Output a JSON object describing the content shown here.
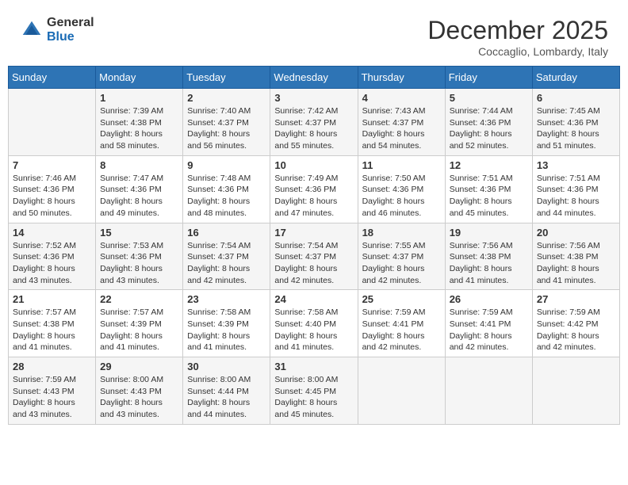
{
  "header": {
    "logo_general": "General",
    "logo_blue": "Blue",
    "month_title": "December 2025",
    "location": "Coccaglio, Lombardy, Italy"
  },
  "days_of_week": [
    "Sunday",
    "Monday",
    "Tuesday",
    "Wednesday",
    "Thursday",
    "Friday",
    "Saturday"
  ],
  "weeks": [
    [
      {
        "day": "",
        "sunrise": "",
        "sunset": "",
        "daylight": ""
      },
      {
        "day": "1",
        "sunrise": "7:39 AM",
        "sunset": "4:38 PM",
        "daylight": "8 hours and 58 minutes."
      },
      {
        "day": "2",
        "sunrise": "7:40 AM",
        "sunset": "4:37 PM",
        "daylight": "8 hours and 56 minutes."
      },
      {
        "day": "3",
        "sunrise": "7:42 AM",
        "sunset": "4:37 PM",
        "daylight": "8 hours and 55 minutes."
      },
      {
        "day": "4",
        "sunrise": "7:43 AM",
        "sunset": "4:37 PM",
        "daylight": "8 hours and 54 minutes."
      },
      {
        "day": "5",
        "sunrise": "7:44 AM",
        "sunset": "4:36 PM",
        "daylight": "8 hours and 52 minutes."
      },
      {
        "day": "6",
        "sunrise": "7:45 AM",
        "sunset": "4:36 PM",
        "daylight": "8 hours and 51 minutes."
      }
    ],
    [
      {
        "day": "7",
        "sunrise": "7:46 AM",
        "sunset": "4:36 PM",
        "daylight": "8 hours and 50 minutes."
      },
      {
        "day": "8",
        "sunrise": "7:47 AM",
        "sunset": "4:36 PM",
        "daylight": "8 hours and 49 minutes."
      },
      {
        "day": "9",
        "sunrise": "7:48 AM",
        "sunset": "4:36 PM",
        "daylight": "8 hours and 48 minutes."
      },
      {
        "day": "10",
        "sunrise": "7:49 AM",
        "sunset": "4:36 PM",
        "daylight": "8 hours and 47 minutes."
      },
      {
        "day": "11",
        "sunrise": "7:50 AM",
        "sunset": "4:36 PM",
        "daylight": "8 hours and 46 minutes."
      },
      {
        "day": "12",
        "sunrise": "7:51 AM",
        "sunset": "4:36 PM",
        "daylight": "8 hours and 45 minutes."
      },
      {
        "day": "13",
        "sunrise": "7:51 AM",
        "sunset": "4:36 PM",
        "daylight": "8 hours and 44 minutes."
      }
    ],
    [
      {
        "day": "14",
        "sunrise": "7:52 AM",
        "sunset": "4:36 PM",
        "daylight": "8 hours and 43 minutes."
      },
      {
        "day": "15",
        "sunrise": "7:53 AM",
        "sunset": "4:36 PM",
        "daylight": "8 hours and 43 minutes."
      },
      {
        "day": "16",
        "sunrise": "7:54 AM",
        "sunset": "4:37 PM",
        "daylight": "8 hours and 42 minutes."
      },
      {
        "day": "17",
        "sunrise": "7:54 AM",
        "sunset": "4:37 PM",
        "daylight": "8 hours and 42 minutes."
      },
      {
        "day": "18",
        "sunrise": "7:55 AM",
        "sunset": "4:37 PM",
        "daylight": "8 hours and 42 minutes."
      },
      {
        "day": "19",
        "sunrise": "7:56 AM",
        "sunset": "4:38 PM",
        "daylight": "8 hours and 41 minutes."
      },
      {
        "day": "20",
        "sunrise": "7:56 AM",
        "sunset": "4:38 PM",
        "daylight": "8 hours and 41 minutes."
      }
    ],
    [
      {
        "day": "21",
        "sunrise": "7:57 AM",
        "sunset": "4:38 PM",
        "daylight": "8 hours and 41 minutes."
      },
      {
        "day": "22",
        "sunrise": "7:57 AM",
        "sunset": "4:39 PM",
        "daylight": "8 hours and 41 minutes."
      },
      {
        "day": "23",
        "sunrise": "7:58 AM",
        "sunset": "4:39 PM",
        "daylight": "8 hours and 41 minutes."
      },
      {
        "day": "24",
        "sunrise": "7:58 AM",
        "sunset": "4:40 PM",
        "daylight": "8 hours and 41 minutes."
      },
      {
        "day": "25",
        "sunrise": "7:59 AM",
        "sunset": "4:41 PM",
        "daylight": "8 hours and 42 minutes."
      },
      {
        "day": "26",
        "sunrise": "7:59 AM",
        "sunset": "4:41 PM",
        "daylight": "8 hours and 42 minutes."
      },
      {
        "day": "27",
        "sunrise": "7:59 AM",
        "sunset": "4:42 PM",
        "daylight": "8 hours and 42 minutes."
      }
    ],
    [
      {
        "day": "28",
        "sunrise": "7:59 AM",
        "sunset": "4:43 PM",
        "daylight": "8 hours and 43 minutes."
      },
      {
        "day": "29",
        "sunrise": "8:00 AM",
        "sunset": "4:43 PM",
        "daylight": "8 hours and 43 minutes."
      },
      {
        "day": "30",
        "sunrise": "8:00 AM",
        "sunset": "4:44 PM",
        "daylight": "8 hours and 44 minutes."
      },
      {
        "day": "31",
        "sunrise": "8:00 AM",
        "sunset": "4:45 PM",
        "daylight": "8 hours and 45 minutes."
      },
      {
        "day": "",
        "sunrise": "",
        "sunset": "",
        "daylight": ""
      },
      {
        "day": "",
        "sunrise": "",
        "sunset": "",
        "daylight": ""
      },
      {
        "day": "",
        "sunrise": "",
        "sunset": "",
        "daylight": ""
      }
    ]
  ]
}
